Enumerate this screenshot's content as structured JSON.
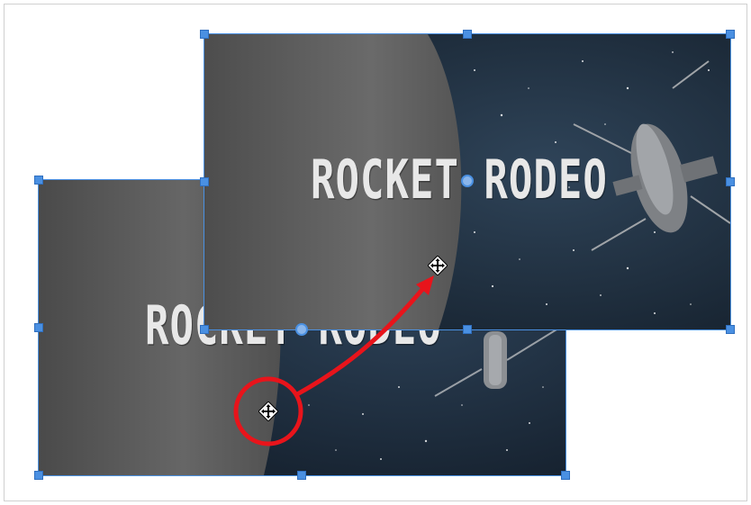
{
  "slides": {
    "back": {
      "title": "ROCKET RODEO"
    },
    "front": {
      "title": "ROCKET RODEO"
    }
  },
  "icons": {
    "move_cursor": "move-cursor-icon",
    "rotate_handle": "rotate-handle-icon",
    "drag_arrow": "drag-arrow-icon",
    "highlight_circle": "highlight-circle"
  },
  "colors": {
    "selection": "#4a90e2",
    "annotation": "#e8141b",
    "space": "#1c2b3c",
    "planet": "#5a5a5a"
  }
}
